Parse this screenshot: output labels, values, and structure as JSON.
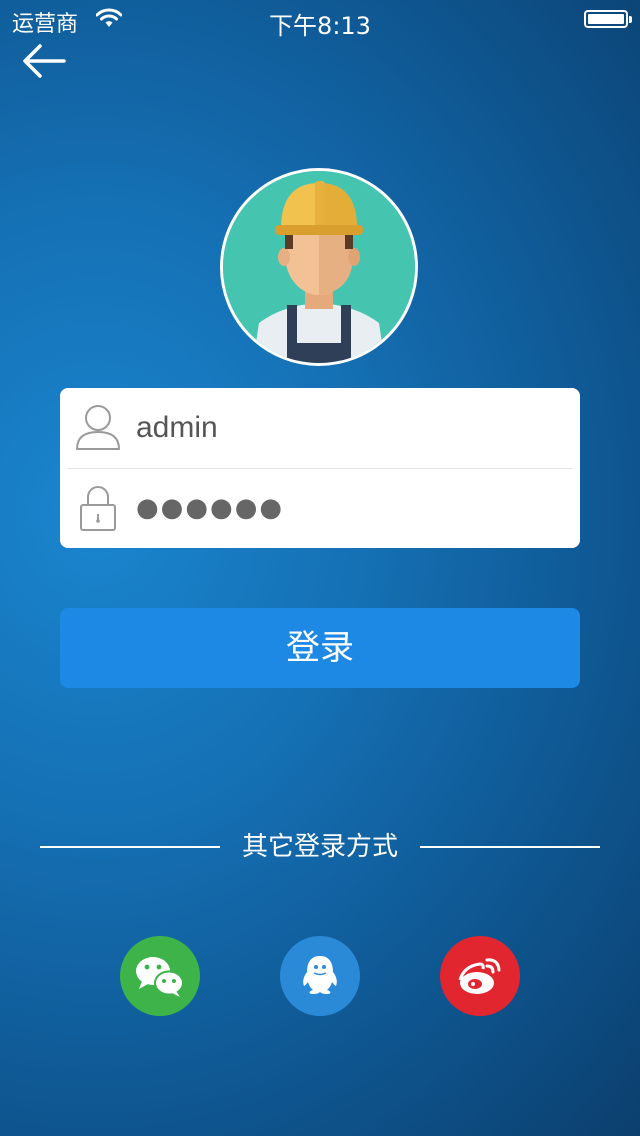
{
  "status_bar": {
    "carrier": "运营商",
    "time": "下午8:13"
  },
  "login_form": {
    "username_value": "admin",
    "password_masked": "●●●●●●"
  },
  "login_button": {
    "label": "登录"
  },
  "other_login": {
    "title": "其它登录方式",
    "providers": [
      {
        "icon": "wechat-icon",
        "color": "#3db34a"
      },
      {
        "icon": "qq-icon",
        "color": "#2a8ad8"
      },
      {
        "icon": "weibo-icon",
        "color": "#e2262f"
      }
    ]
  },
  "colors": {
    "primary_button": "#1e88e5",
    "avatar_background": "#45c4b0"
  }
}
